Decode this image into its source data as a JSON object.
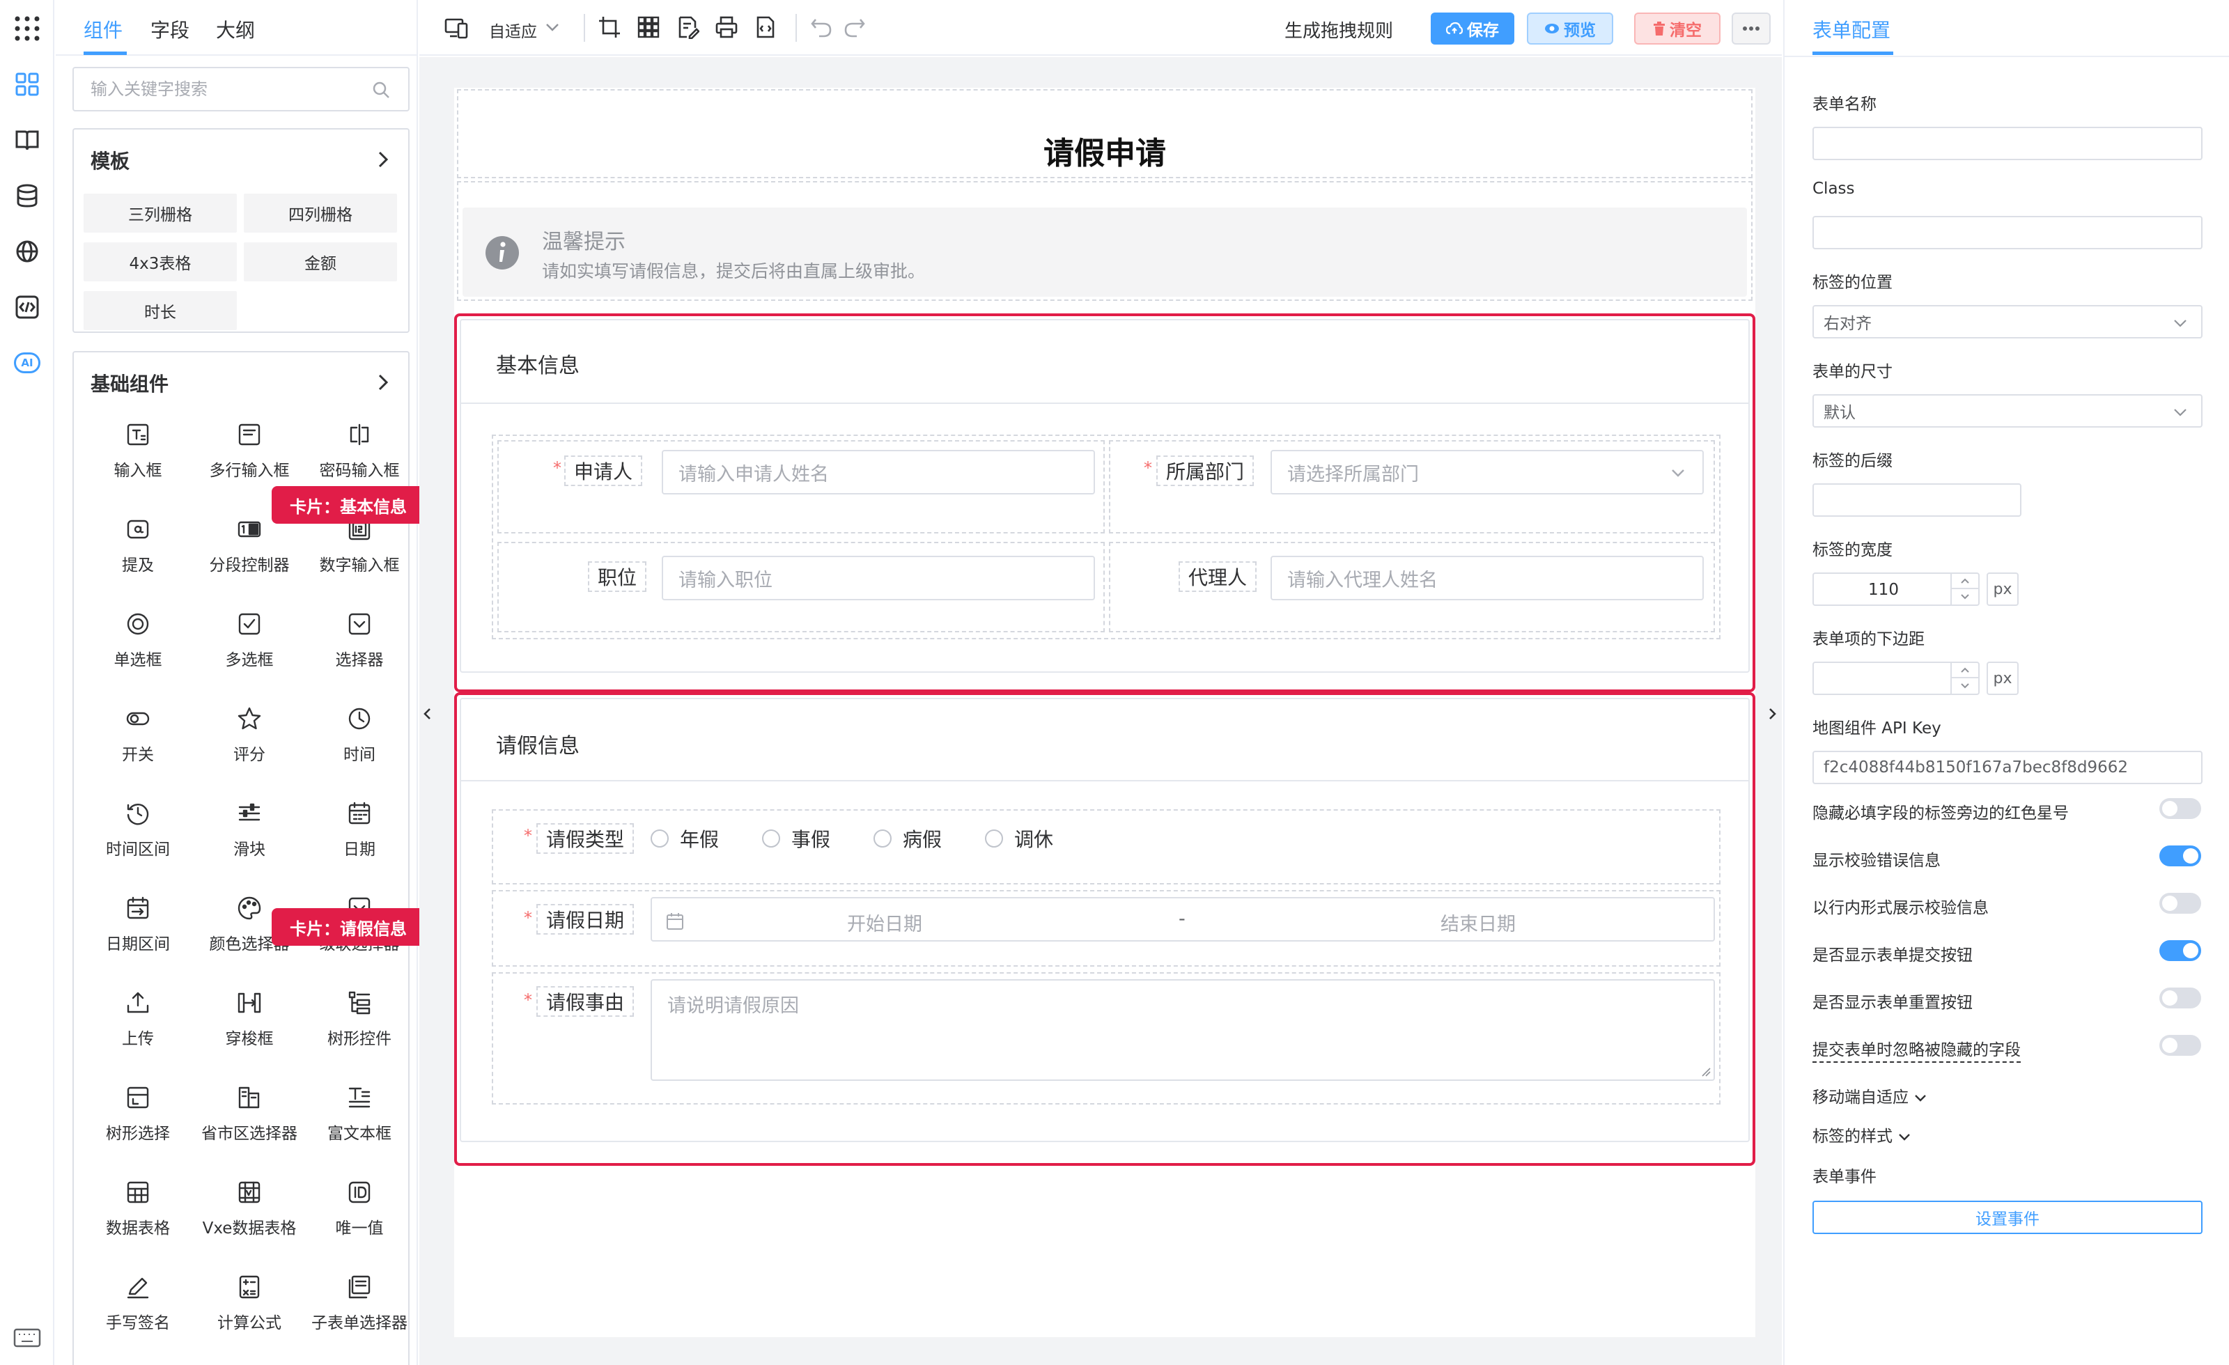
{
  "left_tabs": [
    "组件",
    "字段",
    "大纲"
  ],
  "search": {
    "placeholder": "输入关键字搜索"
  },
  "templates": {
    "title": "模板",
    "items": [
      "三列栅格",
      "四列栅格",
      "4x3表格",
      "金额",
      "时长"
    ]
  },
  "basic": {
    "title": "基础组件",
    "items": [
      {
        "label": "输入框",
        "icon": "text-input-icon"
      },
      {
        "label": "多行输入框",
        "icon": "textarea-icon"
      },
      {
        "label": "密码输入框",
        "icon": "password-icon"
      },
      {
        "label": "提及",
        "icon": "mention-icon"
      },
      {
        "label": "分段控制器",
        "icon": "segmented-icon"
      },
      {
        "label": "数字输入框",
        "icon": "number-input-icon"
      },
      {
        "label": "单选框",
        "icon": "radio-icon"
      },
      {
        "label": "多选框",
        "icon": "checkbox-icon"
      },
      {
        "label": "选择器",
        "icon": "select-icon"
      },
      {
        "label": "开关",
        "icon": "switch-icon"
      },
      {
        "label": "评分",
        "icon": "star-icon"
      },
      {
        "label": "时间",
        "icon": "clock-icon"
      },
      {
        "label": "时间区间",
        "icon": "time-range-icon"
      },
      {
        "label": "滑块",
        "icon": "slider-icon"
      },
      {
        "label": "日期",
        "icon": "calendar-icon"
      },
      {
        "label": "日期区间",
        "icon": "date-range-icon"
      },
      {
        "label": "颜色选择器",
        "icon": "palette-icon"
      },
      {
        "label": "级联选择器",
        "icon": "cascader-icon"
      },
      {
        "label": "上传",
        "icon": "upload-icon"
      },
      {
        "label": "穿梭框",
        "icon": "transfer-icon"
      },
      {
        "label": "树形控件",
        "icon": "tree-icon"
      },
      {
        "label": "树形选择",
        "icon": "tree-select-icon"
      },
      {
        "label": "省市区选择器",
        "icon": "region-icon"
      },
      {
        "label": "富文本框",
        "icon": "rich-text-icon"
      },
      {
        "label": "数据表格",
        "icon": "table-icon"
      },
      {
        "label": "Vxe数据表格",
        "icon": "vxe-table-icon"
      },
      {
        "label": "唯一值",
        "icon": "id-icon"
      },
      {
        "label": "手写签名",
        "icon": "signature-icon"
      },
      {
        "label": "计算公式",
        "icon": "calculator-icon"
      },
      {
        "label": "子表单选择器",
        "icon": "subform-icon"
      }
    ]
  },
  "callouts": {
    "card1": "卡片：基本信息",
    "card2": "卡片：请假信息"
  },
  "toolbar": {
    "adaptive": "自适应",
    "gen_rules": "生成拖拽规则",
    "save": "保存",
    "preview": "预览",
    "clear": "清空"
  },
  "form": {
    "title": "请假申请",
    "tip": {
      "title": "温馨提示",
      "desc": "请如实填写请假信息，提交后将由直属上级审批。"
    },
    "card1": {
      "title": "基本信息",
      "applicant": {
        "label": "申请人",
        "placeholder": "请输入申请人姓名"
      },
      "dept": {
        "label": "所属部门",
        "placeholder": "请选择所属部门"
      },
      "position": {
        "label": "职位",
        "placeholder": "请输入职位"
      },
      "agent": {
        "label": "代理人",
        "placeholder": "请输入代理人姓名"
      }
    },
    "card2": {
      "title": "请假信息",
      "type": {
        "label": "请假类型",
        "options": [
          "年假",
          "事假",
          "病假",
          "调休"
        ]
      },
      "date": {
        "label": "请假日期",
        "start": "开始日期",
        "sep": "-",
        "end": "结束日期"
      },
      "reason": {
        "label": "请假事由",
        "placeholder": "请说明请假原因"
      }
    },
    "required_mark": "*"
  },
  "config": {
    "tab": "表单配置",
    "form_name": {
      "label": "表单名称",
      "value": ""
    },
    "class": {
      "label": "Class",
      "value": ""
    },
    "label_position": {
      "label": "标签的位置",
      "value": "右对齐"
    },
    "form_size": {
      "label": "表单的尺寸",
      "value": "默认"
    },
    "label_suffix": {
      "label": "标签的后缀",
      "value": ""
    },
    "label_width": {
      "label": "标签的宽度",
      "value": "110",
      "unit": "px"
    },
    "item_margin": {
      "label": "表单项的下边距",
      "value": "",
      "unit": "px"
    },
    "map_key": {
      "label": "地图组件 API Key",
      "value": "f2c4088f44b8150f167a7bec8f8d9662"
    },
    "switches": [
      {
        "label": "隐藏必填字段的标签旁边的红色星号",
        "on": false
      },
      {
        "label": "显示校验错误信息",
        "on": true
      },
      {
        "label": "以行内形式展示校验信息",
        "on": false
      },
      {
        "label": "是否显示表单提交按钮",
        "on": true
      },
      {
        "label": "是否显示表单重置按钮",
        "on": false
      },
      {
        "label": "提交表单时忽略被隐藏的字段",
        "on": false
      }
    ],
    "mobile": "移动端自适应",
    "label_style": "标签的样式",
    "events": {
      "label": "表单事件",
      "button": "设置事件"
    }
  },
  "colors": {
    "accent": "#409eff",
    "highlight": "#e11d48",
    "danger": "#f56c6c"
  }
}
